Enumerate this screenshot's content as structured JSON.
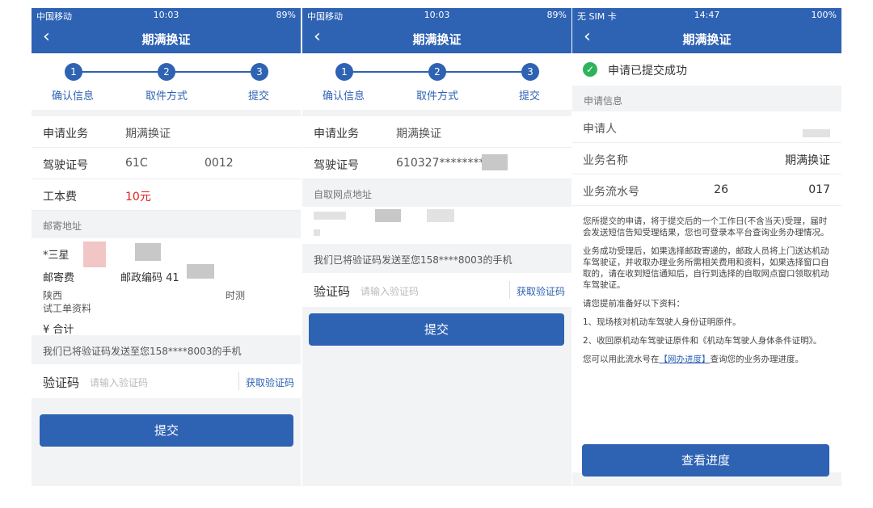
{
  "panel1": {
    "status": {
      "carrier": "中国移动",
      "time": "10:03",
      "battery": "89%"
    },
    "title": "期满换证",
    "steps": [
      "确认信息",
      "取件方式",
      "提交"
    ],
    "step_numbers": [
      "1",
      "2",
      "3"
    ],
    "rows": [
      {
        "k": "申请业务",
        "v": "期满换证"
      },
      {
        "k": "驾驶证号",
        "v": "61C",
        "v2": "0012"
      },
      {
        "k": "工本费",
        "v": "10元"
      }
    ],
    "mail_section": "邮寄地址",
    "mail_name": "*三星",
    "mail_fee": "邮寄费",
    "postcode": "邮政编码 41",
    "address_1": "陕西",
    "address_2": "试工单资料",
    "address_tail": "时测",
    "total": "¥ 合计",
    "sms_note": "我们已将验证码发送至您158****8003的手机",
    "vcode_label": "验证码",
    "vcode_placeholder": "请输入验证码",
    "get_code": "获取验证码",
    "submit": "提交"
  },
  "panel2": {
    "status": {
      "carrier": "中国移动",
      "time": "10:03",
      "battery": "89%"
    },
    "title": "期满换证",
    "steps": [
      "确认信息",
      "取件方式",
      "提交"
    ],
    "step_numbers": [
      "1",
      "2",
      "3"
    ],
    "rows": [
      {
        "k": "申请业务",
        "v": "期满换证"
      },
      {
        "k": "驾驶证号",
        "v": "610327********"
      }
    ],
    "pickup_section": "自取网点地址",
    "sms_note": "我们已将验证码发送至您158****8003的手机",
    "vcode_label": "验证码",
    "vcode_placeholder": "请输入验证码",
    "get_code": "获取验证码",
    "submit": "提交"
  },
  "panel3": {
    "status": {
      "carrier": "无 SIM 卡",
      "time": "14:47",
      "battery": "100%"
    },
    "title": "期满换证",
    "success": "申请已提交成功",
    "info_section": "申请信息",
    "rows": [
      {
        "k": "申请人",
        "v": ""
      },
      {
        "k": "业务名称",
        "v": "期满换证"
      },
      {
        "k": "业务流水号",
        "v": "26",
        "v2": "017"
      }
    ],
    "para1": "您所提交的申请，将于提交后的一个工作日(不含当天)受理，届时会发送短信告知受理结果，您也可登录本平台查询业务办理情况。",
    "para2": "业务成功受理后，如果选择邮政寄递的，邮政人员将上门送达机动车驾驶证，并收取办理业务所需相关费用和资料，如果选择窗口自取的，请在收到短信通知后，自行到选择的自取网点窗口领取机动车驾驶证。",
    "para3": "请您提前准备好以下资料：",
    "para4": "1、现场核对机动车驾驶人身份证明原件。",
    "para5": "2、收回原机动车驾驶证原件和《机动车驾驶人身体条件证明》。",
    "para6_pre": "您可以用此流水号在",
    "para6_link": "【网办进度】",
    "para6_post": "查询您的业务办理进度。",
    "button": "查看进度"
  }
}
